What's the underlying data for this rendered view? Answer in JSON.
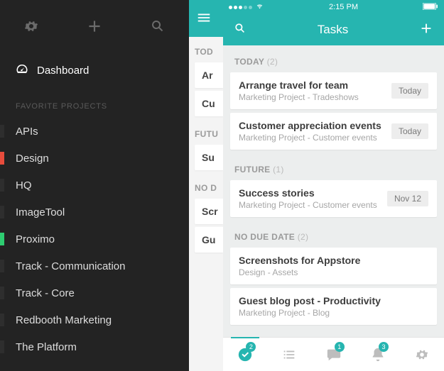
{
  "statusbar": {
    "time": "2:15 PM"
  },
  "sidebar": {
    "dashboard_label": "Dashboard",
    "section_label": "FAVORITE PROJECTS",
    "projects": [
      {
        "label": "APIs",
        "color": "#2e2e2e"
      },
      {
        "label": "Design",
        "color": "#e74c3c"
      },
      {
        "label": "HQ",
        "color": "#2e2e2e"
      },
      {
        "label": "ImageTool",
        "color": "#2e2e2e"
      },
      {
        "label": "Proximo",
        "color": "#2ecc71"
      },
      {
        "label": "Track - Communication",
        "color": "#2e2e2e"
      },
      {
        "label": "Track - Core",
        "color": "#2e2e2e"
      },
      {
        "label": "Redbooth Marketing",
        "color": "#2e2e2e"
      },
      {
        "label": "The Platform",
        "color": "#2e2e2e"
      }
    ]
  },
  "peek": {
    "sections": [
      {
        "head": "TOD",
        "cards": [
          "Ar",
          "Cu"
        ]
      },
      {
        "head": "FUTU",
        "cards": [
          "Su"
        ]
      },
      {
        "head": "NO D",
        "cards": [
          "Scr",
          "Gu"
        ]
      }
    ]
  },
  "tasks": {
    "title": "Tasks",
    "groups": [
      {
        "head": "TODAY",
        "count": "(2)",
        "items": [
          {
            "title": "Arrange travel for team",
            "sub": "Marketing Project - Tradeshows",
            "badge": "Today"
          },
          {
            "title": "Customer appreciation events",
            "sub": "Marketing Project - Customer events",
            "badge": "Today"
          }
        ]
      },
      {
        "head": "FUTURE",
        "count": "(1)",
        "items": [
          {
            "title": "Success stories",
            "sub": "Marketing Project - Customer events",
            "badge": "Nov 12"
          }
        ]
      },
      {
        "head": "NO DUE DATE",
        "count": "(2)",
        "items": [
          {
            "title": "Screenshots for Appstore",
            "sub": "Design - Assets",
            "badge": ""
          },
          {
            "title": "Guest blog post - Productivity",
            "sub": "Marketing Project - Blog",
            "badge": ""
          }
        ]
      }
    ]
  },
  "tabbar": {
    "badges": {
      "tasks": "2",
      "chat": "1",
      "notifications": "3"
    }
  }
}
